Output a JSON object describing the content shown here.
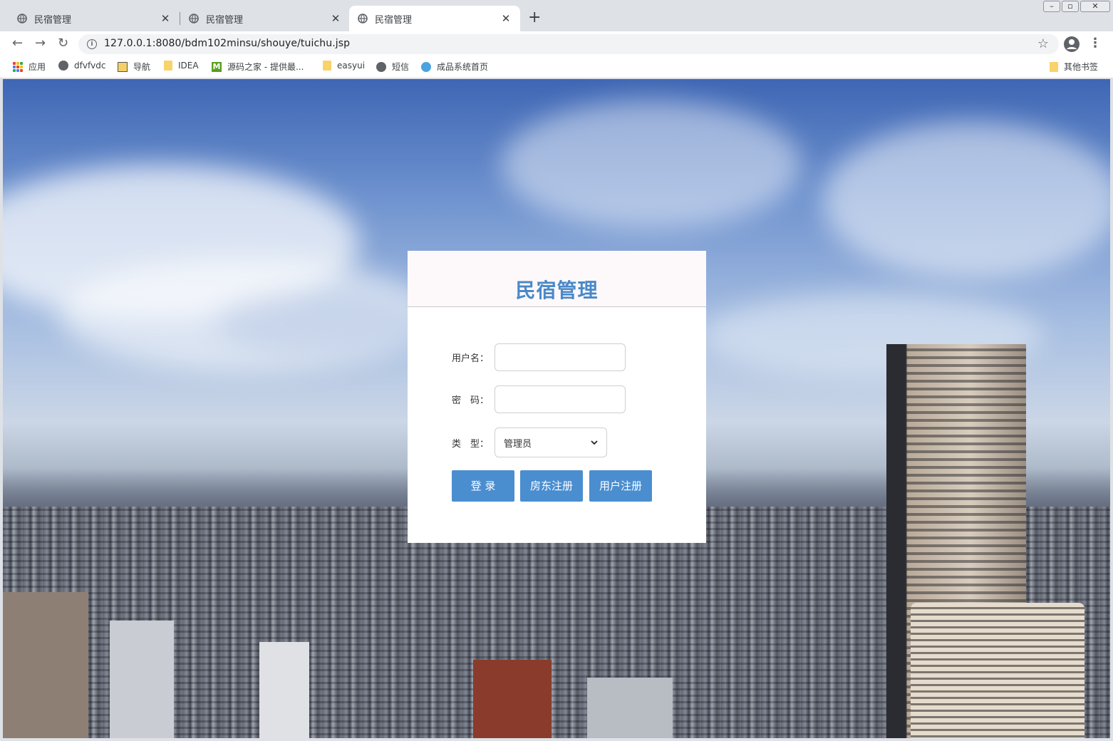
{
  "browser": {
    "tabs": [
      {
        "title": "民宿管理",
        "active": false
      },
      {
        "title": "民宿管理",
        "active": false
      },
      {
        "title": "民宿管理",
        "active": true
      }
    ],
    "new_tab_symbol": "+",
    "close_symbol": "✕",
    "url": "127.0.0.1:8080/bdm102minsu/shouye/tuichu.jsp",
    "window_controls": {
      "minimize": "–",
      "restore": "▫",
      "close": "✕"
    }
  },
  "bookmarks": {
    "apps": "应用",
    "items": [
      {
        "label": "dfvfvdc",
        "icon": "globe-icon"
      },
      {
        "label": "导航",
        "icon": "image-icon"
      },
      {
        "label": "IDEA",
        "icon": "folder-icon"
      },
      {
        "label": "源码之家 - 提供最...",
        "icon": "m-logo-icon"
      },
      {
        "label": "easyui",
        "icon": "folder-icon"
      },
      {
        "label": "短信",
        "icon": "globe-icon"
      },
      {
        "label": "成品系统首页",
        "icon": "home-icon"
      }
    ],
    "other": "其他书签"
  },
  "login": {
    "title": "民宿管理",
    "username_label": "用户名：",
    "username_value": "",
    "password_label": "密　码：",
    "password_value": "",
    "type_label": "类　型：",
    "type_selected": "管理员",
    "login_button": "登 录",
    "landlord_register_button": "房东注册",
    "user_register_button": "用户注册"
  },
  "colors": {
    "accent": "#4a8ed0",
    "title": "#4a89c8"
  }
}
